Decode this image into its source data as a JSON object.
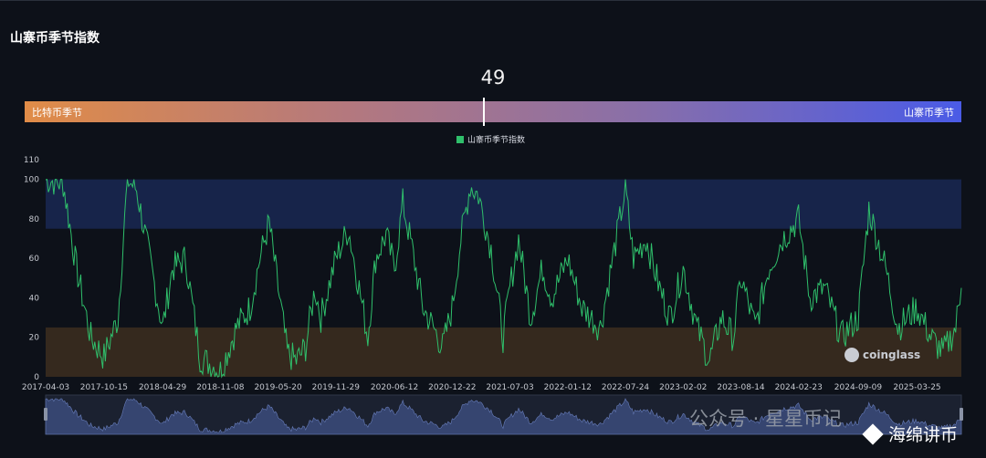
{
  "title": "山寨币季节指数",
  "gauge": {
    "value": "49",
    "left_label": "比特币季节",
    "right_label": "山寨币季节"
  },
  "legend": {
    "label": "山寨币季节指数",
    "color": "#2fbf6b"
  },
  "brand": "coinglass",
  "watermark": "公众号 · 星星币记",
  "credit": "海绵讲币",
  "chart_data": {
    "type": "line",
    "title": "山寨币季节指数",
    "ylim": [
      0,
      110
    ],
    "yticks": [
      0,
      20,
      40,
      60,
      80,
      100,
      110
    ],
    "xticks": [
      "2017-04-03",
      "2017-10-15",
      "2018-04-29",
      "2018-11-08",
      "2019-05-20",
      "2019-11-29",
      "2020-06-12",
      "2020-12-22",
      "2021-07-03",
      "2022-01-12",
      "2022-07-24",
      "2023-02-02",
      "2023-08-14",
      "2024-02-23",
      "2024-09-09",
      "2025-03-25"
    ],
    "bands": [
      {
        "name": "山寨币季节",
        "from": 75,
        "to": 100,
        "color": "#17244a"
      },
      {
        "name": "比特币季节",
        "from": 0,
        "to": 25,
        "color": "#35291e"
      }
    ],
    "series": [
      {
        "name": "山寨币季节指数",
        "color": "#2fbf6b",
        "x": [
          "2017-04-03",
          "2017-06-01",
          "2017-07-15",
          "2017-09-01",
          "2017-10-15",
          "2017-12-01",
          "2018-01-01",
          "2018-02-01",
          "2018-04-29",
          "2018-06-01",
          "2018-07-15",
          "2018-09-01",
          "2018-11-08",
          "2019-01-01",
          "2019-02-15",
          "2019-03-20",
          "2019-04-20",
          "2019-05-20",
          "2019-06-20",
          "2019-07-20",
          "2019-08-20",
          "2019-09-20",
          "2019-10-10",
          "2019-11-29",
          "2020-01-10",
          "2020-02-15",
          "2020-03-15",
          "2020-04-10",
          "2020-05-15",
          "2020-06-12",
          "2020-07-10",
          "2020-08-10",
          "2020-09-15",
          "2020-10-20",
          "2020-11-20",
          "2020-12-22",
          "2021-01-20",
          "2021-02-20",
          "2021-03-20",
          "2021-05-01",
          "2021-06-10",
          "2021-07-03",
          "2021-08-01",
          "2021-09-10",
          "2021-10-20",
          "2021-11-20",
          "2022-01-12",
          "2022-03-01",
          "2022-05-01",
          "2022-07-24",
          "2022-08-20",
          "2022-10-01",
          "2022-11-15",
          "2022-12-20",
          "2023-02-02",
          "2023-03-20",
          "2023-05-01",
          "2023-06-10",
          "2023-07-20",
          "2023-08-14",
          "2023-10-01",
          "2023-11-15",
          "2024-01-01",
          "2024-02-23",
          "2024-04-01",
          "2024-05-20",
          "2024-07-15",
          "2024-09-09",
          "2024-10-15",
          "2024-12-10",
          "2025-01-20",
          "2025-03-25",
          "2025-05-10",
          "2025-06-20",
          "2025-08-01",
          "2025-08-20"
        ],
        "values": [
          100,
          98,
          55,
          20,
          10,
          30,
          100,
          95,
          25,
          55,
          60,
          10,
          3,
          25,
          35,
          60,
          78,
          45,
          12,
          8,
          15,
          45,
          30,
          60,
          75,
          45,
          20,
          60,
          72,
          55,
          88,
          65,
          35,
          25,
          15,
          35,
          70,
          97,
          92,
          65,
          20,
          45,
          70,
          30,
          55,
          40,
          60,
          35,
          25,
          95,
          60,
          70,
          45,
          30,
          55,
          25,
          8,
          30,
          20,
          50,
          25,
          55,
          70,
          80,
          40,
          45,
          20,
          30,
          85,
          55,
          25,
          35,
          20,
          12,
          25,
          45
        ]
      }
    ]
  }
}
